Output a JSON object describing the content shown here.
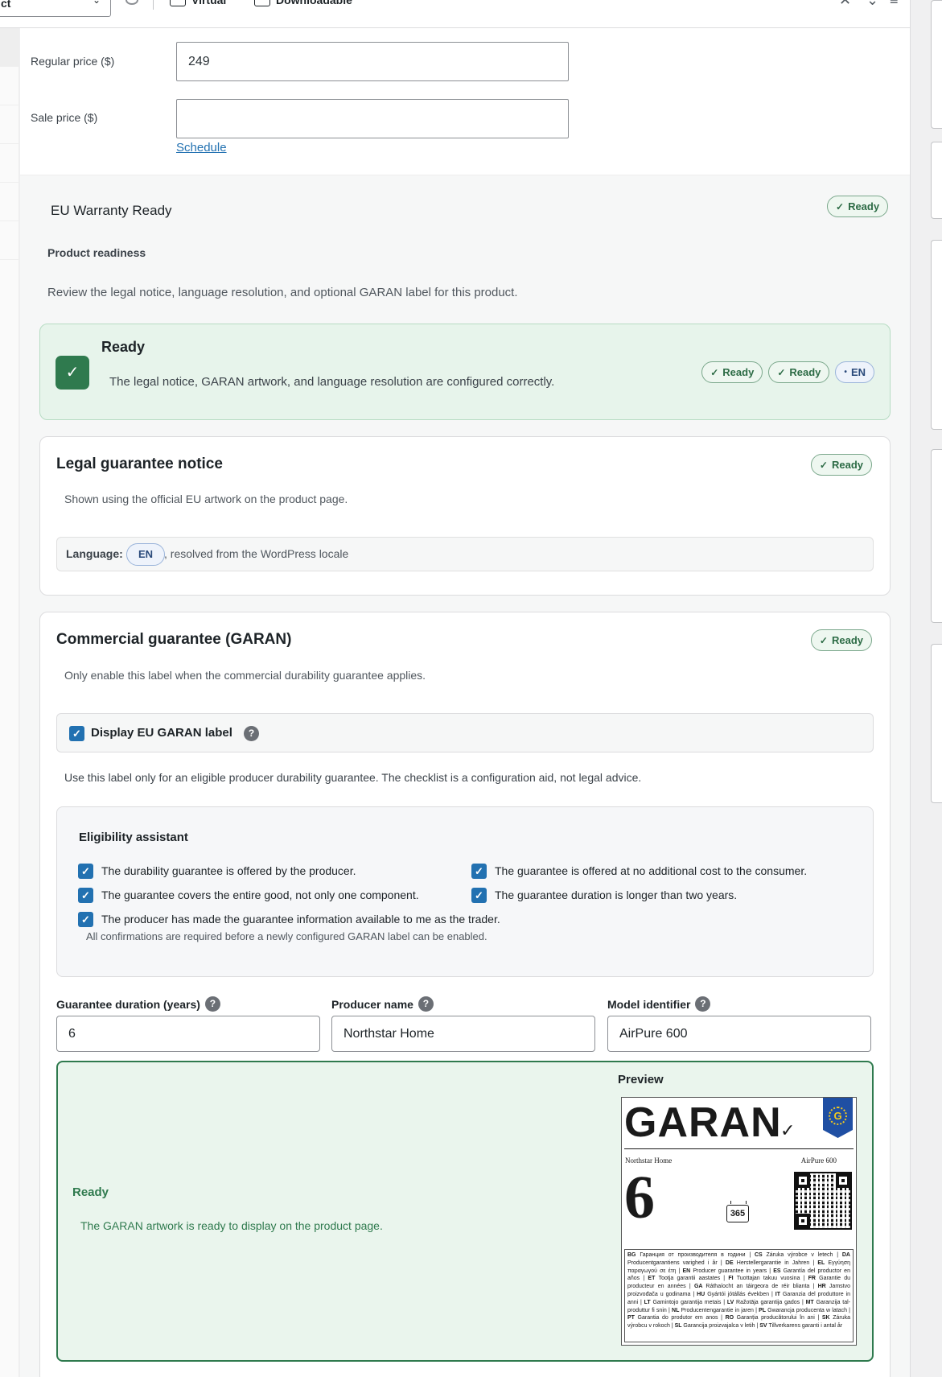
{
  "toolbar": {
    "product_type_value": "ct",
    "virtual_label": "Virtual",
    "downloadable_label": "Downloadable"
  },
  "pricing": {
    "regular_price_label": "Regular price ($)",
    "regular_price_value": "249",
    "sale_price_label": "Sale price ($)",
    "sale_price_value": "",
    "schedule_link": "Schedule"
  },
  "eu_warranty": {
    "title": "EU Warranty Ready",
    "title_badge": "Ready",
    "readiness_heading": "Product readiness",
    "readiness_description": "Review the legal notice, language resolution, and optional GARAN label for this product.",
    "status_card": {
      "title": "Ready",
      "text": "The legal notice, GARAN artwork, and language resolution are configured correctly.",
      "badges": [
        "Ready",
        "Ready"
      ],
      "language_badge": "EN"
    },
    "legal_notice": {
      "title": "Legal guarantee notice",
      "badge": "Ready",
      "subtitle": "Shown using the official EU artwork on the product page.",
      "language_label": "Language:",
      "language_code": "EN",
      "language_resolution": ", resolved from the WordPress locale"
    },
    "commercial": {
      "title": "Commercial guarantee (GARAN)",
      "badge": "Ready",
      "subtitle": "Only enable this label when the commercial durability guarantee applies.",
      "display_label": "Display EU GARAN label",
      "display_checked": true,
      "note": "Use this label only for an eligible producer durability guarantee. The checklist is a configuration aid, not legal advice.",
      "eligibility": {
        "title": "Eligibility assistant",
        "items": [
          "The durability guarantee is offered by the producer.",
          "The guarantee is offered at no additional cost to the consumer.",
          "The guarantee covers the entire good, not only one component.",
          "The guarantee duration is longer than two years.",
          "The producer has made the guarantee information available to me as the trader."
        ],
        "footer": "All confirmations are required before a newly configured GARAN label can be enabled."
      },
      "fields": {
        "duration_label": "Guarantee duration (years)",
        "duration_value": "6",
        "producer_label": "Producer name",
        "producer_value": "Northstar Home",
        "model_label": "Model identifier",
        "model_value": "AirPure 600"
      },
      "preview": {
        "status": "Ready",
        "text": "The GARAN artwork is ready to display on the product page.",
        "title": "Preview",
        "label_word": "GARAN",
        "label_producer": "Northstar Home",
        "label_model": "AirPure 600",
        "label_years": "6",
        "label_days": "365",
        "label_shield_letter": "G",
        "label_languages": [
          {
            "code": "BG",
            "text": "Гаранция от производителя в години"
          },
          {
            "code": "CS",
            "text": "Záruka výrobce v letech"
          },
          {
            "code": "DA",
            "text": "Producentgarantiens varighed i år"
          },
          {
            "code": "DE",
            "text": "Herstellergarantie in Jahren"
          },
          {
            "code": "EL",
            "text": "Εγγύηση παραγωγού σε έτη"
          },
          {
            "code": "EN",
            "text": "Producer guarantee in years"
          },
          {
            "code": "ES",
            "text": "Garantía del productor en años"
          },
          {
            "code": "ET",
            "text": "Tootja garantii aastates"
          },
          {
            "code": "FI",
            "text": "Tuottajan takuu vuosina"
          },
          {
            "code": "FR",
            "text": "Garantie du producteur en années"
          },
          {
            "code": "GA",
            "text": "Ráthaíocht an táirgeora de réir blianta"
          },
          {
            "code": "HR",
            "text": "Jamstvo proizvođača u godinama"
          },
          {
            "code": "HU",
            "text": "Gyártói jótállás években"
          },
          {
            "code": "IT",
            "text": "Garanzia del produttore in anni"
          },
          {
            "code": "LT",
            "text": "Gamintojo garantija metais"
          },
          {
            "code": "LV",
            "text": "Ražotāja garantija gados"
          },
          {
            "code": "MT",
            "text": "Garanzija tal-produttur fi snin"
          },
          {
            "code": "NL",
            "text": "Producentengarantie in jaren"
          },
          {
            "code": "PL",
            "text": "Gwarancja producenta w latach"
          },
          {
            "code": "PT",
            "text": "Garantia do produtor em anos"
          },
          {
            "code": "RO",
            "text": "Garanția producătorului în ani"
          },
          {
            "code": "SK",
            "text": "Záruka výrobcu v rokoch"
          },
          {
            "code": "SL",
            "text": "Garancija proizvajalca v letih"
          },
          {
            "code": "SV",
            "text": "Tillverkarens garanti i antal år"
          }
        ]
      }
    }
  },
  "colors": {
    "ready_green": "#2f7a4e",
    "link_blue": "#2271b1",
    "checkbox_blue": "#2271b1"
  }
}
